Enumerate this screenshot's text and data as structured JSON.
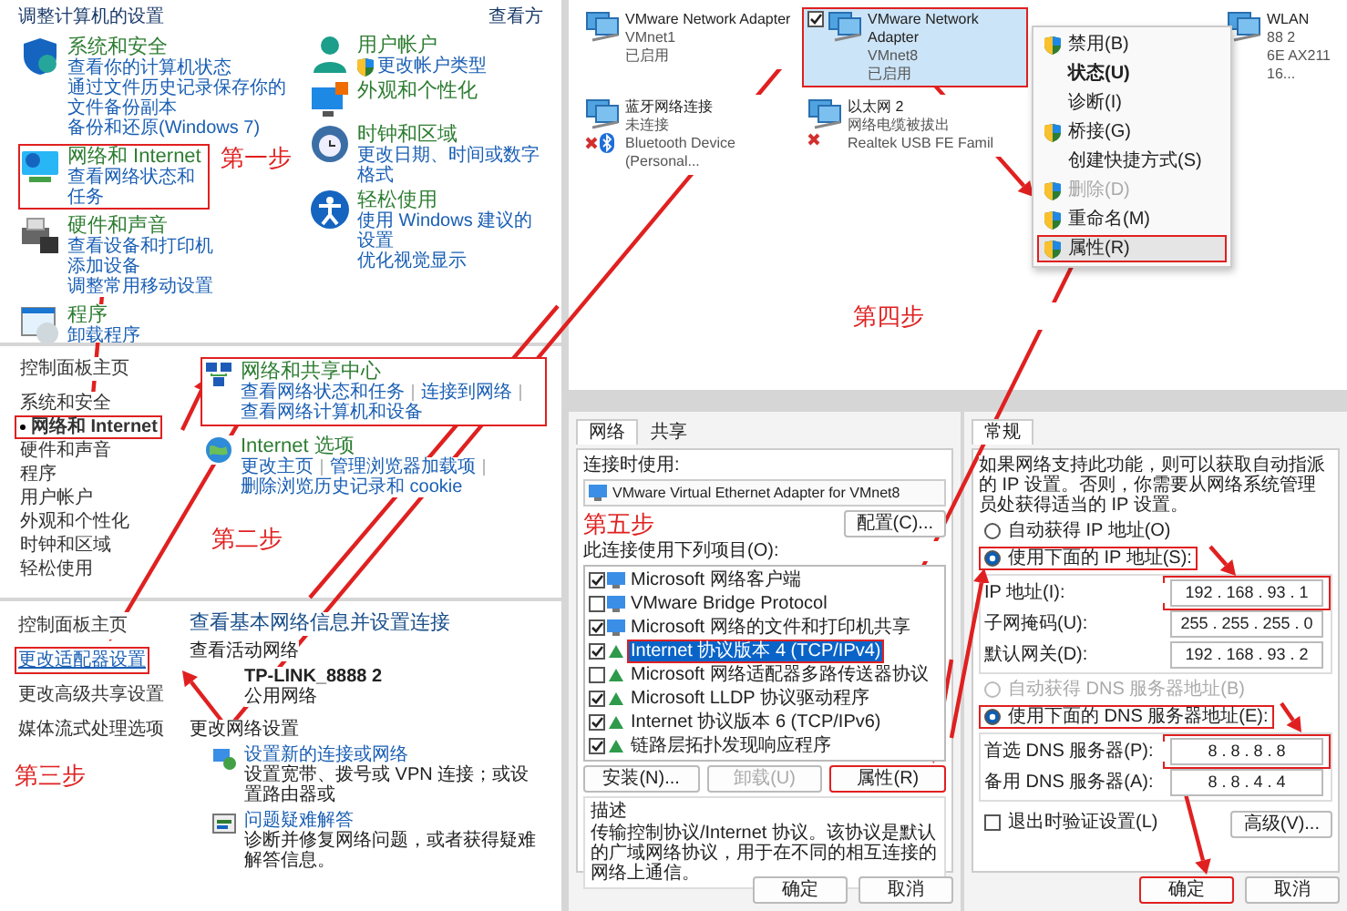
{
  "steps": [
    "第一步",
    "第二步",
    "第三步",
    "第四步",
    "第五步"
  ],
  "control_panel": {
    "title": "调整计算机的设置",
    "view_by": "查看方",
    "left": [
      {
        "title": "系统和安全",
        "links": [
          "查看你的计算机状态",
          "通过文件历史记录保存你的文件备份副本",
          "备份和还原(Windows 7)"
        ],
        "annotated": false
      },
      {
        "title": "网络和 Internet",
        "links": [
          "查看网络状态和任务"
        ],
        "annotated": true
      },
      {
        "title": "硬件和声音",
        "links": [
          "查看设备和打印机",
          "添加设备",
          "调整常用移动设置"
        ],
        "annotated": false
      },
      {
        "title": "程序",
        "links": [
          "卸载程序"
        ],
        "annotated": false
      }
    ],
    "right": [
      {
        "title": "用户帐户",
        "links": [
          "更改帐户类型"
        ]
      },
      {
        "title": "外观和个性化"
      },
      {
        "title": "时钟和区域",
        "links": [
          "更改日期、时间或数字格式"
        ]
      },
      {
        "title": "轻松使用",
        "links": [
          "使用 Windows 建议的设置",
          "优化视觉显示"
        ]
      }
    ]
  },
  "category_page": {
    "nav": [
      {
        "label": "控制面板主页",
        "selected": false,
        "annotated": false
      },
      {
        "label": "系统和安全",
        "selected": false,
        "annotated": false
      },
      {
        "label": "网络和 Internet",
        "selected": true,
        "annotated": true
      },
      {
        "label": "硬件和声音",
        "selected": false,
        "annotated": false
      },
      {
        "label": "程序",
        "selected": false,
        "annotated": false
      },
      {
        "label": "用户帐户",
        "selected": false,
        "annotated": false
      },
      {
        "label": "外观和个性化",
        "selected": false,
        "annotated": false
      },
      {
        "label": "时钟和区域",
        "selected": false,
        "annotated": false
      },
      {
        "label": "轻松使用",
        "selected": false,
        "annotated": false
      }
    ],
    "sections": [
      {
        "title": "网络和共享中心",
        "links": [
          "查看网络状态和任务",
          "连接到网络",
          "查看网络计算机和设备"
        ],
        "annotated": true
      },
      {
        "title": "Internet 选项",
        "links": [
          "更改主页",
          "管理浏览器加载项",
          "删除浏览历史记录和 cookie"
        ],
        "annotated": false
      }
    ]
  },
  "network_center": {
    "nav": [
      {
        "label": "控制面板主页",
        "annotated": false
      },
      {
        "label": "更改适配器设置",
        "annotated": true
      },
      {
        "label": "更改高级共享设置",
        "annotated": false
      },
      {
        "label": "媒体流式处理选项",
        "annotated": false
      }
    ],
    "title": "查看基本网络信息并设置连接",
    "active_heading": "查看活动网络",
    "network_name": "TP-LINK_8888 2",
    "network_type": "公用网络",
    "change_heading": "更改网络设置",
    "tasks": [
      {
        "title": "设置新的连接或网络",
        "description": "设置宽带、拨号或 VPN 连接；或设置路由器或"
      },
      {
        "title": "问题疑难解答",
        "description": "诊断并修复网络问题，或者获得疑难解答信息。"
      }
    ]
  },
  "adapters": {
    "items": [
      {
        "lines": [
          "VMware Network Adapter",
          "VMnet1",
          "已启用"
        ],
        "selected": false,
        "disconnected": false,
        "annotated": false
      },
      {
        "lines": [
          "VMware Network Adapter",
          "VMnet8",
          "已启用"
        ],
        "selected": true,
        "disconnected": false,
        "annotated": true
      },
      {
        "lines": [
          "WLAN",
          "88 2",
          "6E AX211 16..."
        ],
        "selected": false,
        "disconnected": false,
        "annotated": false
      },
      {
        "lines": [
          "蓝牙网络连接",
          "未连接",
          "Bluetooth Device (Personal..."
        ],
        "selected": false,
        "disconnected": true,
        "annotated": false
      },
      {
        "lines": [
          "以太网 2",
          "网络电缆被拔出",
          "Realtek USB FE Famil"
        ],
        "selected": false,
        "disconnected": true,
        "annotated": false
      }
    ],
    "menu": [
      {
        "label": "禁用(B)",
        "shield": true,
        "default": false,
        "disabled": false,
        "annotated": false
      },
      {
        "label": "状态(U)",
        "shield": false,
        "default": true,
        "disabled": false,
        "annotated": false
      },
      {
        "label": "诊断(I)",
        "shield": false,
        "default": false,
        "disabled": false,
        "annotated": false
      },
      {
        "label": "桥接(G)",
        "shield": true,
        "default": false,
        "disabled": false,
        "annotated": false
      },
      {
        "label": "创建快捷方式(S)",
        "shield": false,
        "default": false,
        "disabled": false,
        "annotated": false
      },
      {
        "label": "删除(D)",
        "shield": true,
        "default": false,
        "disabled": true,
        "annotated": false
      },
      {
        "label": "重命名(M)",
        "shield": true,
        "default": false,
        "disabled": false,
        "annotated": false
      },
      {
        "label": "属性(R)",
        "shield": true,
        "default": false,
        "disabled": false,
        "annotated": true
      }
    ]
  },
  "properties": {
    "tabs": [
      {
        "label": "网络",
        "selected": true
      },
      {
        "label": "共享",
        "selected": false
      }
    ],
    "connect_label": "连接时使用:",
    "adapter": "VMware Virtual Ethernet Adapter for VMnet8",
    "configure_button": "配置(C)...",
    "items_label": "此连接使用下列项目(O):",
    "items": [
      {
        "label": "Microsoft 网络客户端",
        "kind": "service",
        "checked": true,
        "selected": false,
        "annotated": false
      },
      {
        "label": "VMware Bridge Protocol",
        "kind": "service",
        "checked": false,
        "selected": false,
        "annotated": false
      },
      {
        "label": "Microsoft 网络的文件和打印机共享",
        "kind": "service",
        "checked": true,
        "selected": false,
        "annotated": false
      },
      {
        "label": "Internet 协议版本 4 (TCP/IPv4)",
        "kind": "protocol",
        "checked": true,
        "selected": true,
        "annotated": true
      },
      {
        "label": "Microsoft 网络适配器多路传送器协议",
        "kind": "protocol",
        "checked": false,
        "selected": false,
        "annotated": false
      },
      {
        "label": "Microsoft LLDP 协议驱动程序",
        "kind": "protocol",
        "checked": true,
        "selected": false,
        "annotated": false
      },
      {
        "label": "Internet 协议版本 6 (TCP/IPv6)",
        "kind": "protocol",
        "checked": true,
        "selected": false,
        "annotated": false
      },
      {
        "label": "链路层拓扑发现响应程序",
        "kind": "protocol",
        "checked": true,
        "selected": false,
        "annotated": false
      }
    ],
    "buttons": [
      {
        "label": "安装(N)...",
        "disabled": false,
        "annotated": false
      },
      {
        "label": "卸载(U)",
        "disabled": true,
        "annotated": false
      },
      {
        "label": "属性(R)",
        "disabled": false,
        "annotated": true
      }
    ],
    "description_title": "描述",
    "description": "传输控制协议/Internet 协议。该协议是默认的广域网络协议，用于在不同的相互连接的网络上通信。",
    "footer_buttons": [
      {
        "label": "确定",
        "annotated": false
      },
      {
        "label": "取消",
        "annotated": false
      }
    ]
  },
  "ipv4": {
    "tabs": [
      {
        "label": "常规",
        "selected": true
      }
    ],
    "intro": "如果网络支持此功能，则可以获取自动指派的 IP 设置。否则，你需要从网络系统管理员处获得适当的 IP 设置。",
    "ip_modes": [
      {
        "label": "自动获得 IP 地址(O)",
        "selected": false,
        "disabled": false,
        "annotated": false
      },
      {
        "label": "使用下面的 IP 地址(S):",
        "selected": true,
        "disabled": false,
        "annotated": true
      }
    ],
    "ip_group": {
      "annotated": true,
      "fields": [
        {
          "label": "IP 地址(I):",
          "value": "192 . 168 . 93 . 1"
        },
        {
          "label": "子网掩码(U):",
          "value": "255 . 255 . 255 . 0"
        },
        {
          "label": "默认网关(D):",
          "value": "192 . 168 . 93 . 2"
        }
      ]
    },
    "dns_modes": [
      {
        "label": "自动获得 DNS 服务器地址(B)",
        "selected": false,
        "disabled": true,
        "annotated": false
      },
      {
        "label": "使用下面的 DNS 服务器地址(E):",
        "selected": true,
        "disabled": false,
        "annotated": true
      }
    ],
    "dns_group": {
      "annotated": true,
      "fields": [
        {
          "label": "首选 DNS 服务器(P):",
          "value": "8 . 8 . 8 . 8"
        },
        {
          "label": "备用 DNS 服务器(A):",
          "value": "8 . 8 . 4 . 4"
        }
      ]
    },
    "validate": {
      "label": "退出时验证设置(L)",
      "checked": false
    },
    "advanced_button": "高级(V)...",
    "footer_buttons": [
      {
        "label": "确定",
        "annotated": true
      },
      {
        "label": "取消",
        "annotated": false
      }
    ]
  }
}
